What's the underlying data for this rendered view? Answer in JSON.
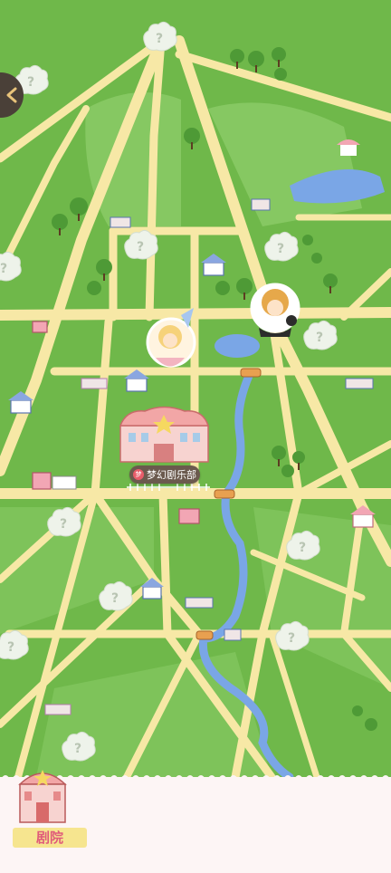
{
  "map": {
    "location_label": "梦幻剧乐部",
    "location_badge": "梦"
  },
  "bottom_nav": {
    "tab_theater_label": "剧院"
  },
  "locked_spot_glyph": "?",
  "colors": {
    "grass": "#6fb84a",
    "road": "#f7e8a6",
    "river": "#7aa6e6",
    "cloud": "#eef3ea",
    "bottom_bar": "#fdf5f5",
    "tab_label_bg": "#f6e58f",
    "tab_label_text": "#e05a7a"
  }
}
